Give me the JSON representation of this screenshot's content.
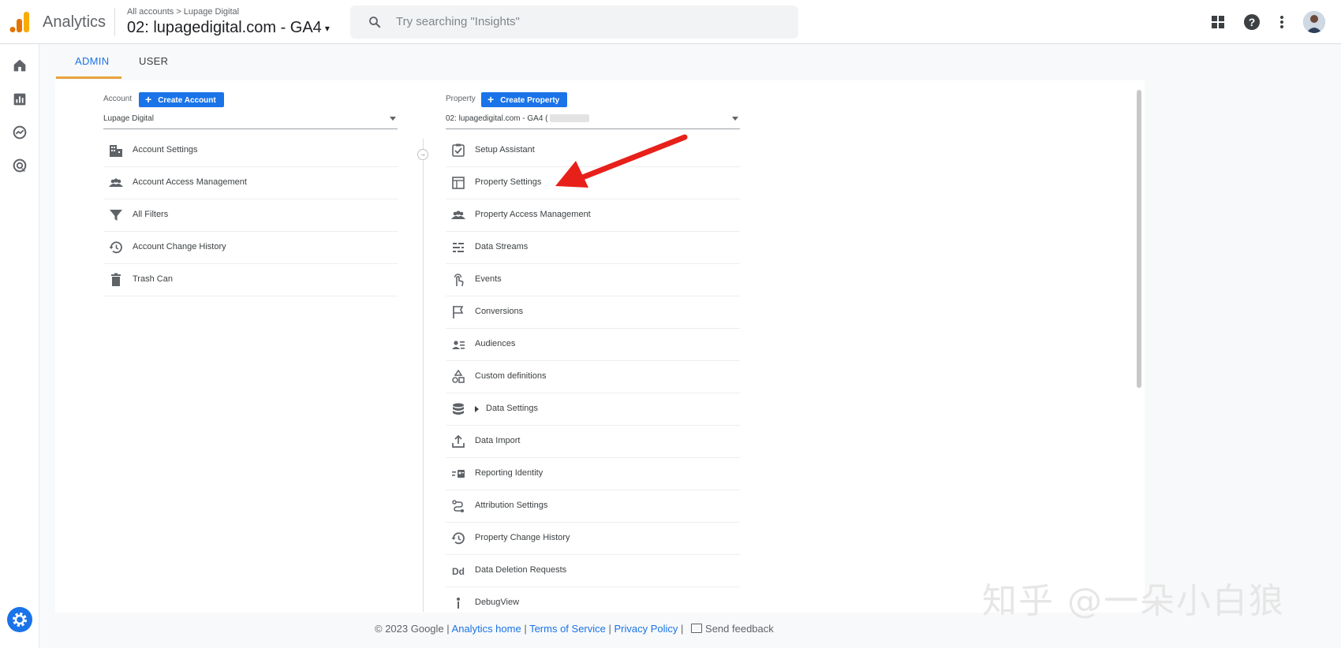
{
  "header": {
    "app_title": "Analytics",
    "breadcrumb_root": "All accounts",
    "breadcrumb_account": "Lupage Digital",
    "property_name": "02: lupagedigital.com - GA4",
    "search_placeholder": "Try searching \"Insights\""
  },
  "tabs": [
    {
      "label": "ADMIN",
      "active": true
    },
    {
      "label": "USER",
      "active": false
    }
  ],
  "account_column": {
    "label": "Account",
    "create_button": "Create Account",
    "selected": "Lupage Digital",
    "items": [
      {
        "label": "Account Settings",
        "icon": "building-icon"
      },
      {
        "label": "Account Access Management",
        "icon": "people-icon"
      },
      {
        "label": "All Filters",
        "icon": "filter-icon"
      },
      {
        "label": "Account Change History",
        "icon": "history-icon"
      },
      {
        "label": "Trash Can",
        "icon": "trash-icon"
      }
    ]
  },
  "property_column": {
    "label": "Property",
    "create_button": "Create Property",
    "selected": "02: lupagedigital.com - GA4 (",
    "items": [
      {
        "label": "Setup Assistant",
        "icon": "checkbox-icon"
      },
      {
        "label": "Property Settings",
        "icon": "layout-icon"
      },
      {
        "label": "Property Access Management",
        "icon": "people-icon"
      },
      {
        "label": "Data Streams",
        "icon": "streams-icon"
      },
      {
        "label": "Events",
        "icon": "touch-icon"
      },
      {
        "label": "Conversions",
        "icon": "flag-icon"
      },
      {
        "label": "Audiences",
        "icon": "audience-icon"
      },
      {
        "label": "Custom definitions",
        "icon": "shapes-icon"
      },
      {
        "label": "Data Settings",
        "icon": "database-icon"
      },
      {
        "label": "Data Import",
        "icon": "upload-icon"
      },
      {
        "label": "Reporting Identity",
        "icon": "identity-icon"
      },
      {
        "label": "Attribution Settings",
        "icon": "attribution-icon"
      },
      {
        "label": "Property Change History",
        "icon": "history-icon"
      },
      {
        "label": "Data Deletion Requests",
        "icon": "dd-icon"
      },
      {
        "label": "DebugView",
        "icon": "debug-icon"
      }
    ]
  },
  "footer": {
    "copyright": "© 2023 Google |",
    "analytics_home": "Analytics home",
    "terms": "Terms of Service",
    "privacy": "Privacy Policy",
    "feedback": "Send feedback"
  },
  "watermark": "知乎 @一朵小白狼",
  "colors": {
    "accent": "#1a73e8",
    "tab_underline": "#e8a33b",
    "arrow": "#e8201a"
  }
}
